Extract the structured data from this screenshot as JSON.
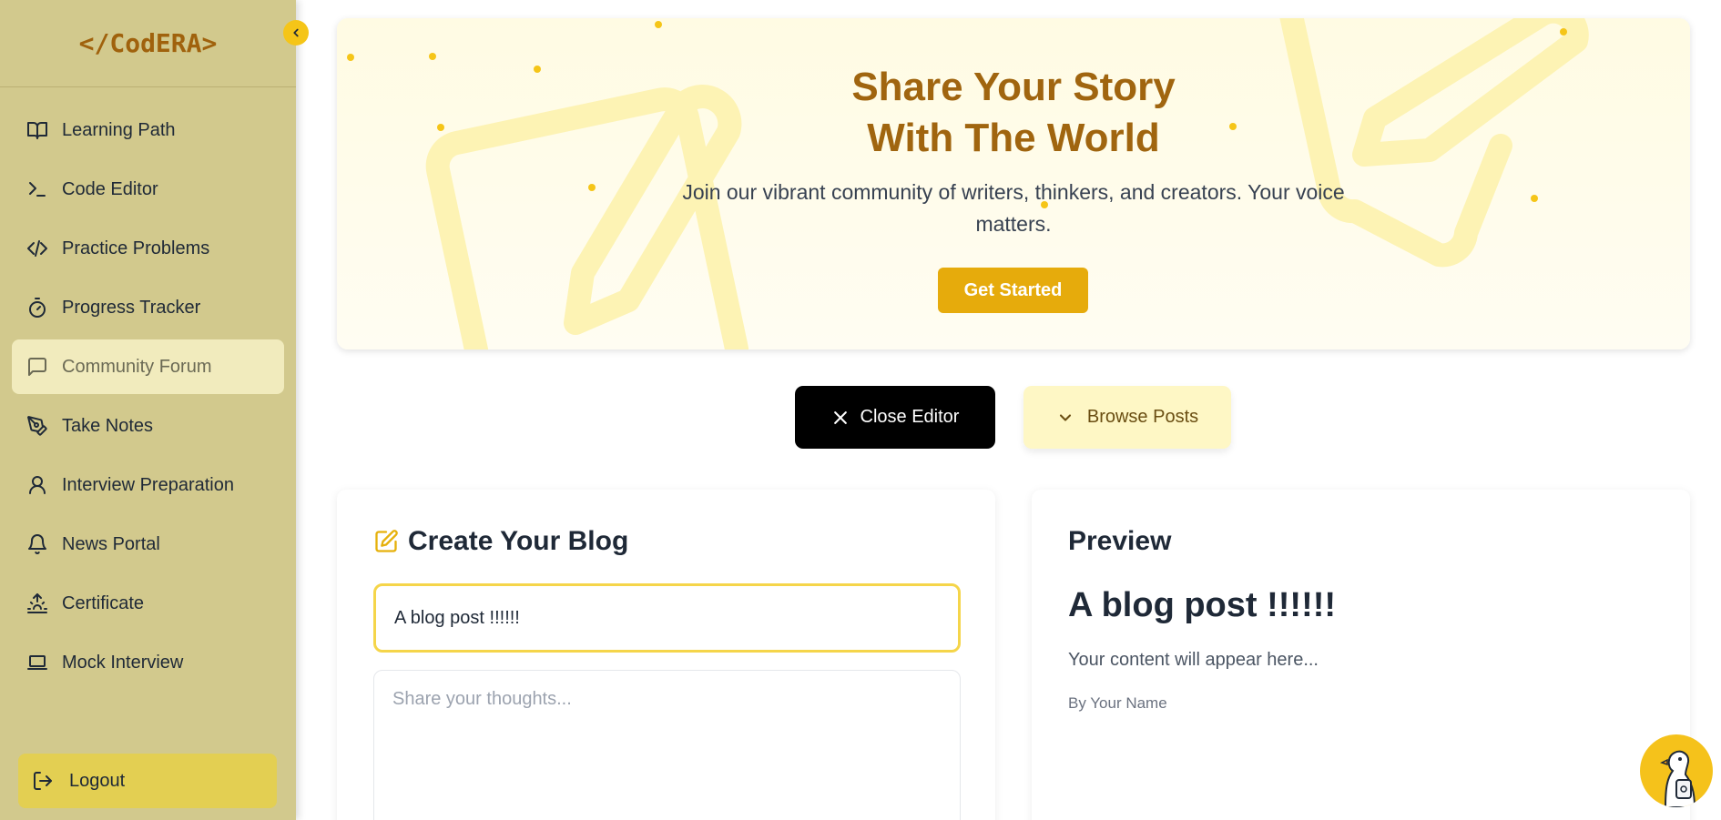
{
  "brand": {
    "logo_text": "</CodERA>"
  },
  "sidebar": {
    "items": [
      {
        "label": "Learning Path",
        "icon": "book-open-icon"
      },
      {
        "label": "Code Editor",
        "icon": "terminal-icon"
      },
      {
        "label": "Practice Problems",
        "icon": "code-icon"
      },
      {
        "label": "Progress Tracker",
        "icon": "timer-icon"
      },
      {
        "label": "Community Forum",
        "icon": "message-square-icon",
        "active": true
      },
      {
        "label": "Take Notes",
        "icon": "pen-tool-icon"
      },
      {
        "label": "Interview Preparation",
        "icon": "user-icon"
      },
      {
        "label": "News Portal",
        "icon": "bell-icon"
      },
      {
        "label": "Certificate",
        "icon": "sunrise-icon"
      },
      {
        "label": "Mock Interview",
        "icon": "laptop-icon"
      }
    ],
    "logout_label": "Logout"
  },
  "hero": {
    "title_line1": "Share Your Story",
    "title_line2": "With The World",
    "subtitle": "Join our vibrant community of writers, thinkers, and creators. Your voice matters.",
    "cta_label": "Get Started"
  },
  "actions": {
    "close_editor_label": "Close Editor",
    "browse_posts_label": "Browse Posts"
  },
  "editor": {
    "heading": "Create Your Blog",
    "title_value": "A blog post !!!!!!",
    "content_placeholder": "Share your thoughts..."
  },
  "preview": {
    "heading": "Preview",
    "title": "A blog post !!!!!!",
    "content": "Your content will appear here...",
    "author": "By Your Name"
  },
  "colors": {
    "sidebar_bg": "#d2c98d",
    "accent": "#f5c518",
    "brand": "#a0620d",
    "cta": "#e6ab0c"
  }
}
